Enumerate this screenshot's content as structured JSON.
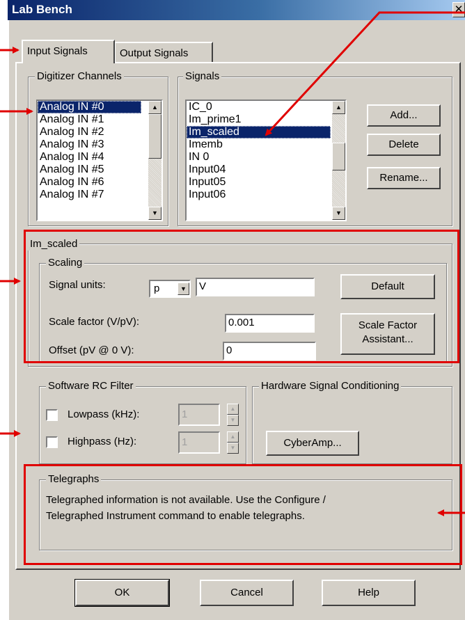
{
  "window": {
    "title": "Lab Bench",
    "close_glyph": "✕"
  },
  "tabs": [
    {
      "label": "Input Signals",
      "active": true
    },
    {
      "label": "Output Signals",
      "active": false
    }
  ],
  "digitizer": {
    "label": "Digitizer Channels",
    "items": [
      "Analog IN #0",
      "Analog IN #1",
      "Analog IN #2",
      "Analog IN #3",
      "Analog IN #4",
      "Analog IN #5",
      "Analog IN #6",
      "Analog IN #7"
    ],
    "selected_index": 0
  },
  "signals": {
    "label": "Signals",
    "items": [
      "IC_0",
      "Im_prime1",
      "Im_scaled",
      "Imemb",
      "IN 0",
      "Input04",
      "Input05",
      "Input06"
    ],
    "selected_index": 2,
    "add_label": "Add...",
    "delete_label": "Delete",
    "rename_label": "Rename..."
  },
  "signal_group": {
    "label": "Im_scaled",
    "scaling": {
      "label": "Scaling",
      "units_label": "Signal units:",
      "units_prefix": "p",
      "units_value": "V",
      "scale_label": "Scale factor (V/pV):",
      "scale_value": "0.001",
      "offset_label": "Offset (pV @ 0 V):",
      "offset_value": "0",
      "default_label": "Default",
      "assistant_line1": "Scale Factor",
      "assistant_line2": "Assistant..."
    }
  },
  "rc_filter": {
    "label": "Software RC Filter",
    "lowpass_label": "Lowpass (kHz):",
    "lowpass_value": "1",
    "lowpass_checked": false,
    "highpass_label": "Highpass (Hz):",
    "highpass_value": "1",
    "highpass_checked": false
  },
  "hardware": {
    "label": "Hardware Signal Conditioning",
    "cyberamp_label": "CyberAmp..."
  },
  "telegraphs": {
    "label": "Telegraphs",
    "line1": "Telegraphed information is not available. Use the Configure /",
    "line2": "Telegraphed Instrument command to enable telegraphs."
  },
  "footer": {
    "ok_label": "OK",
    "cancel_label": "Cancel",
    "help_label": "Help"
  },
  "colors": {
    "annotation": "#e00000",
    "dialog_bg": "#d4d0c8",
    "selection": "#0a246a"
  }
}
